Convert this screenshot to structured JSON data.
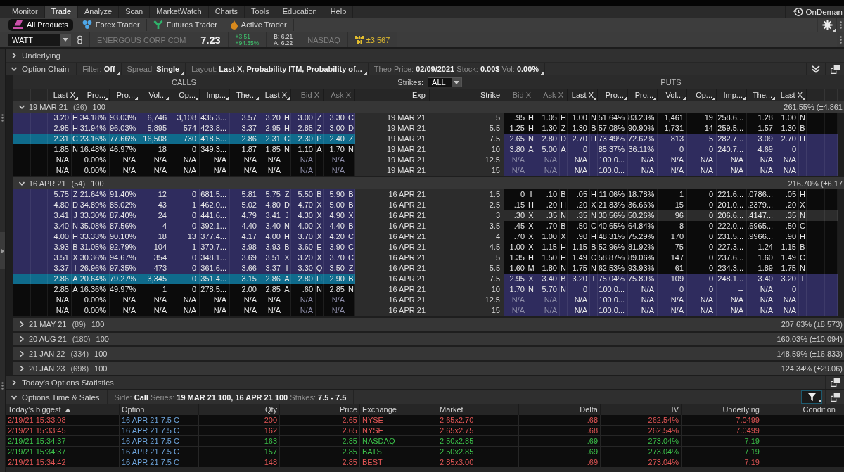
{
  "menu": {
    "tabs": [
      {
        "label": "Monitor",
        "selected": false
      },
      {
        "label": "Trade",
        "selected": true
      },
      {
        "label": "Analyze",
        "selected": false
      },
      {
        "label": "Scan",
        "selected": false
      },
      {
        "label": "MarketWatch",
        "selected": false
      },
      {
        "label": "Charts",
        "selected": false
      },
      {
        "label": "Tools",
        "selected": false
      },
      {
        "label": "Education",
        "selected": false
      },
      {
        "label": "Help",
        "selected": false
      }
    ],
    "ondemand": "OnDeman"
  },
  "product_tabs": [
    {
      "label": "All Products",
      "selected": true
    },
    {
      "label": "Forex Trader",
      "selected": false
    },
    {
      "label": "Futures Trader",
      "selected": false
    },
    {
      "label": "Active Trader",
      "selected": false
    }
  ],
  "symbol_bar": {
    "symbol": "WATT",
    "description": "ENERGOUS CORP COM",
    "last": "7.23",
    "net_change": "+3.51",
    "percent_change": "+94.35%",
    "bid": "B: 6.21",
    "ask": "A: 6.22",
    "exchange": "NASDAQ",
    "expected_move": "±3.567"
  },
  "underlying": {
    "label": "Underlying",
    "expanded": false
  },
  "option_chain": {
    "label": "Option Chain",
    "expanded": true,
    "controls": [
      {
        "parts": [
          {
            "label": "Filter:",
            "value": "Off"
          }
        ]
      },
      {
        "parts": [
          {
            "label": "Spread:",
            "value": "Single"
          }
        ]
      },
      {
        "parts": [
          {
            "label": "Layout:",
            "value": "Last X, Probability ITM, Probability of..."
          }
        ]
      },
      {
        "parts": [
          {
            "label": "Theo Price:",
            "value": "02/09/2021"
          },
          {
            "label": "Stock:",
            "value": "0.00$"
          },
          {
            "label": "Vol:",
            "value": "0.00%"
          }
        ]
      }
    ]
  },
  "chain": {
    "calls_label": "CALLS",
    "puts_label": "PUTS",
    "strikes": {
      "label": "Strikes:",
      "value": "ALL"
    },
    "call_columns": [
      {
        "label": "Last X",
        "kind": "trade",
        "menu": true
      },
      {
        "label": "Pro...",
        "kind": "stat",
        "menu": true
      },
      {
        "label": "Pro...",
        "kind": "stat",
        "menu": true
      },
      {
        "label": "Vol...",
        "kind": "stat",
        "menu": true
      },
      {
        "label": "Op...",
        "kind": "stat",
        "menu": true
      },
      {
        "label": "Imp...",
        "kind": "stat",
        "menu": true
      },
      {
        "label": "The...",
        "kind": "stat",
        "menu": true
      },
      {
        "label": "Last X",
        "kind": "trade",
        "menu": true
      },
      {
        "label": "Bid X",
        "kind": "quote",
        "menu": false
      },
      {
        "label": "Ask X",
        "kind": "quote",
        "menu": false
      }
    ],
    "middle_columns": [
      {
        "label": "Exp"
      },
      {
        "label": "Strike"
      }
    ],
    "put_columns": [
      {
        "label": "Bid X",
        "kind": "quote",
        "menu": false
      },
      {
        "label": "Ask X",
        "kind": "quote",
        "menu": false
      },
      {
        "label": "Last X",
        "kind": "trade",
        "menu": true
      },
      {
        "label": "Pro...",
        "kind": "stat",
        "menu": true
      },
      {
        "label": "Pro...",
        "kind": "stat",
        "menu": true
      },
      {
        "label": "Vol...",
        "kind": "stat",
        "menu": true
      },
      {
        "label": "Op...",
        "kind": "stat",
        "menu": true
      },
      {
        "label": "Imp...",
        "kind": "stat",
        "menu": true
      },
      {
        "label": "The...",
        "kind": "stat",
        "menu": true
      },
      {
        "label": "Last X",
        "kind": "trade",
        "menu": true
      }
    ],
    "series": [
      {
        "expiration": "19 MAR 21",
        "days": "(26)",
        "multiplier": "100",
        "volatility": "261.55% (±4.861",
        "expanded": true,
        "rows": [
          {
            "exp": "19 MAR 21",
            "strike": "5",
            "selected": false,
            "call_itm": true,
            "put_itm": false,
            "hovered": false,
            "quoted": true,
            "calls": [
              [
                "3.20",
                "H"
              ],
              "34.18%",
              "93.03%",
              "6,746",
              "3,108",
              "435.3...",
              "3.57",
              [
                "3.20",
                "H"
              ],
              [
                "3.00",
                "Z"
              ],
              [
                "3.30",
                "C"
              ]
            ],
            "puts": [
              [
                ".95",
                "H"
              ],
              [
                "1.05",
                "H"
              ],
              [
                "1.00",
                "N"
              ],
              "51.64%",
              "83.23%",
              "1,461",
              "19",
              "258.6...",
              "1.28",
              [
                "1.00",
                "N"
              ]
            ]
          },
          {
            "exp": "19 MAR 21",
            "strike": "5.5",
            "selected": false,
            "call_itm": true,
            "put_itm": false,
            "hovered": false,
            "quoted": true,
            "calls": [
              [
                "2.95",
                "H"
              ],
              "31.94%",
              "96.03%",
              "5,895",
              "574",
              "423.8...",
              "3.37",
              [
                "2.95",
                "H"
              ],
              [
                "2.85",
                "Z"
              ],
              [
                "3.00",
                "D"
              ]
            ],
            "puts": [
              [
                "1.25",
                "H"
              ],
              [
                "1.30",
                "Z"
              ],
              [
                "1.30",
                "B"
              ],
              "57.08%",
              "90.90%",
              "1,731",
              "14",
              "259.5...",
              "1.57",
              [
                "1.30",
                "B"
              ]
            ]
          },
          {
            "exp": "19 MAR 21",
            "strike": "7.5",
            "selected": true,
            "call_itm": false,
            "put_itm": true,
            "hovered": false,
            "quoted": true,
            "calls": [
              [
                "2.31",
                "C"
              ],
              "23.16%",
              "77.66%",
              "16,508",
              "730",
              "418.5...",
              "2.86",
              [
                "2.31",
                "C"
              ],
              [
                "2.30",
                "P"
              ],
              [
                "2.40",
                "Z"
              ]
            ],
            "puts": [
              [
                "2.65",
                "N"
              ],
              [
                "2.80",
                "D"
              ],
              [
                "2.70",
                "H"
              ],
              "73.49%",
              "72.62%",
              "813",
              "5",
              "282.7...",
              "3.09",
              [
                "2.70",
                "H"
              ]
            ]
          },
          {
            "exp": "19 MAR 21",
            "strike": "10",
            "selected": false,
            "call_itm": false,
            "put_itm": true,
            "hovered": false,
            "quoted": true,
            "calls": [
              [
                "1.85",
                "N"
              ],
              "16.48%",
              "46.97%",
              "18",
              "0",
              "349.3...",
              "1.87",
              [
                "1.85",
                "N"
              ],
              [
                "1.10",
                "A"
              ],
              [
                "1.70",
                "N"
              ]
            ],
            "puts": [
              [
                "3.80",
                "A"
              ],
              [
                "5.00",
                "A"
              ],
              [
                "0"
              ],
              "85.37%",
              "36.11%",
              "0",
              "0",
              "240.7...",
              "4.69",
              [
                "0"
              ]
            ]
          },
          {
            "exp": "19 MAR 21",
            "strike": "12.5",
            "selected": false,
            "call_itm": false,
            "put_itm": true,
            "hovered": false,
            "quoted": false,
            "calls": [
              [
                "N/A"
              ],
              "0.00%",
              "N/A",
              "N/A",
              "N/A",
              "N/A",
              "N/A",
              [
                "N/A"
              ],
              [
                "N/A"
              ],
              [
                "N/A"
              ]
            ],
            "puts": [
              [
                "N/A"
              ],
              [
                "N/A"
              ],
              [
                "N/A"
              ],
              "100.0...",
              "N/A",
              "N/A",
              "N/A",
              "N/A",
              "N/A",
              [
                "N/A"
              ]
            ]
          },
          {
            "exp": "19 MAR 21",
            "strike": "15",
            "selected": false,
            "call_itm": false,
            "put_itm": true,
            "hovered": false,
            "quoted": false,
            "calls": [
              [
                "N/A"
              ],
              "0.00%",
              "N/A",
              "N/A",
              "N/A",
              "N/A",
              "N/A",
              [
                "N/A"
              ],
              [
                "N/A"
              ],
              [
                "N/A"
              ]
            ],
            "puts": [
              [
                "N/A"
              ],
              [
                "N/A"
              ],
              [
                "N/A"
              ],
              "100.0...",
              "N/A",
              "N/A",
              "N/A",
              "N/A",
              "N/A",
              [
                "N/A"
              ]
            ]
          }
        ]
      },
      {
        "expiration": "16 APR 21",
        "days": "(54)",
        "multiplier": "100",
        "volatility": "216.70% (±6.17",
        "expanded": true,
        "rows": [
          {
            "exp": "16 APR 21",
            "strike": "1.5",
            "selected": false,
            "call_itm": true,
            "put_itm": false,
            "hovered": false,
            "quoted": true,
            "calls": [
              [
                "5.75",
                "Z"
              ],
              "21.64%",
              "91.40%",
              "12",
              "0",
              "681.5...",
              "5.81",
              [
                "5.75",
                "Z"
              ],
              [
                "5.50",
                "B"
              ],
              [
                "5.90",
                "B"
              ]
            ],
            "puts": [
              [
                "0",
                "I"
              ],
              [
                ".10",
                "B"
              ],
              [
                ".05",
                "H"
              ],
              "11.06%",
              "18.78%",
              "1",
              "0",
              "221.6...",
              ".0786...",
              [
                ".05",
                "H"
              ]
            ]
          },
          {
            "exp": "16 APR 21",
            "strike": "2.5",
            "selected": false,
            "call_itm": true,
            "put_itm": false,
            "hovered": false,
            "quoted": true,
            "calls": [
              [
                "4.80",
                "D"
              ],
              "34.89%",
              "85.02%",
              "43",
              "1",
              "462.0...",
              "5.02",
              [
                "4.80",
                "D"
              ],
              [
                "4.70",
                "X"
              ],
              [
                "5.00",
                "B"
              ]
            ],
            "puts": [
              [
                ".15",
                "H"
              ],
              [
                ".20",
                "H"
              ],
              [
                ".20",
                "X"
              ],
              "21.83%",
              "36.66%",
              "15",
              "0",
              "201.0...",
              ".2379...",
              [
                ".20",
                "X"
              ]
            ]
          },
          {
            "exp": "16 APR 21",
            "strike": "3",
            "selected": false,
            "call_itm": true,
            "put_itm": false,
            "hovered": true,
            "quoted": true,
            "calls": [
              [
                "3.41",
                "J"
              ],
              "33.30%",
              "87.40%",
              "24",
              "0",
              "441.6...",
              "4.79",
              [
                "3.41",
                "J"
              ],
              [
                "4.30",
                "X"
              ],
              [
                "4.90",
                "X"
              ]
            ],
            "puts": [
              [
                ".30",
                "X"
              ],
              [
                ".35",
                "N"
              ],
              [
                ".35",
                "N"
              ],
              "30.56%",
              "50.26%",
              "96",
              "0",
              "206.6...",
              ".4147...",
              [
                ".35",
                "N"
              ]
            ]
          },
          {
            "exp": "16 APR 21",
            "strike": "3.5",
            "selected": false,
            "call_itm": true,
            "put_itm": false,
            "hovered": false,
            "quoted": true,
            "calls": [
              [
                "3.40",
                "N"
              ],
              "35.08%",
              "87.56%",
              "4",
              "0",
              "392.1...",
              "4.40",
              [
                "3.40",
                "N"
              ],
              [
                "4.00",
                "X"
              ],
              [
                "4.40",
                "B"
              ]
            ],
            "puts": [
              [
                ".45",
                "X"
              ],
              [
                ".70",
                "B"
              ],
              [
                ".50",
                "C"
              ],
              "40.65%",
              "64.84%",
              "8",
              "0",
              "222.0...",
              ".6965...",
              [
                ".50",
                "C"
              ]
            ]
          },
          {
            "exp": "16 APR 21",
            "strike": "4",
            "selected": false,
            "call_itm": true,
            "put_itm": false,
            "hovered": false,
            "quoted": true,
            "calls": [
              [
                "4.00",
                "H"
              ],
              "33.33%",
              "90.10%",
              "18",
              "13",
              "377.4...",
              "4.17",
              [
                "4.00",
                "H"
              ],
              [
                "3.70",
                "X"
              ],
              [
                "4.20",
                "C"
              ]
            ],
            "puts": [
              [
                ".70",
                "X"
              ],
              [
                "1.00",
                "X"
              ],
              [
                ".90",
                "H"
              ],
              "48.31%",
              "75.29%",
              "170",
              "0",
              "231.5...",
              ".9966...",
              [
                ".90",
                "H"
              ]
            ]
          },
          {
            "exp": "16 APR 21",
            "strike": "4.5",
            "selected": false,
            "call_itm": true,
            "put_itm": false,
            "hovered": false,
            "quoted": true,
            "calls": [
              [
                "3.93",
                "B"
              ],
              "31.05%",
              "92.79%",
              "104",
              "1",
              "370.7...",
              "3.98",
              [
                "3.93",
                "B"
              ],
              [
                "3.60",
                "E"
              ],
              [
                "3.90",
                "C"
              ]
            ],
            "puts": [
              [
                "1.00",
                "X"
              ],
              [
                "1.15",
                "H"
              ],
              [
                "1.15",
                "B"
              ],
              "52.96%",
              "81.92%",
              "75",
              "0",
              "227.3...",
              "1.24",
              [
                "1.15",
                "B"
              ]
            ]
          },
          {
            "exp": "16 APR 21",
            "strike": "5",
            "selected": false,
            "call_itm": true,
            "put_itm": false,
            "hovered": false,
            "quoted": true,
            "calls": [
              [
                "3.51",
                "X"
              ],
              "30.36%",
              "94.67%",
              "354",
              "0",
              "348.1...",
              "3.69",
              [
                "3.51",
                "X"
              ],
              [
                "3.20",
                "X"
              ],
              [
                "3.70",
                "C"
              ]
            ],
            "puts": [
              [
                "1.35",
                "H"
              ],
              [
                "1.50",
                "H"
              ],
              [
                "1.49",
                "C"
              ],
              "58.87%",
              "89.06%",
              "147",
              "0",
              "237.6...",
              "1.60",
              [
                "1.49",
                "C"
              ]
            ]
          },
          {
            "exp": "16 APR 21",
            "strike": "5.5",
            "selected": false,
            "call_itm": true,
            "put_itm": false,
            "hovered": false,
            "quoted": true,
            "calls": [
              [
                "3.37",
                "I"
              ],
              "26.96%",
              "97.35%",
              "473",
              "0",
              "361.6...",
              "3.66",
              [
                "3.37",
                "I"
              ],
              [
                "3.30",
                "Q"
              ],
              [
                "3.50",
                "Z"
              ]
            ],
            "puts": [
              [
                "1.60",
                "M"
              ],
              [
                "1.80",
                "N"
              ],
              [
                "1.75",
                "N"
              ],
              "62.53%",
              "93.93%",
              "61",
              "0",
              "234.3...",
              "1.89",
              [
                "1.75",
                "N"
              ]
            ]
          },
          {
            "exp": "16 APR 21",
            "strike": "7.5",
            "selected": true,
            "call_itm": false,
            "put_itm": true,
            "hovered": false,
            "quoted": true,
            "calls": [
              [
                "2.86",
                "A"
              ],
              "20.64%",
              "79.27%",
              "3,345",
              "0",
              "351.4...",
              "3.15",
              [
                "2.86",
                "A"
              ],
              [
                "2.80",
                "H"
              ],
              [
                "2.90",
                "B"
              ]
            ],
            "puts": [
              [
                "2.95",
                "X"
              ],
              [
                "3.40",
                "B"
              ],
              [
                "3.20",
                "I"
              ],
              "75.04%",
              "75.80%",
              "109",
              "0",
              "248.1...",
              "3.40",
              [
                "3.20",
                "I"
              ]
            ]
          },
          {
            "exp": "16 APR 21",
            "strike": "10",
            "selected": false,
            "call_itm": false,
            "put_itm": true,
            "hovered": false,
            "quoted": true,
            "calls": [
              [
                "2.85",
                "A"
              ],
              "16.36%",
              "49.97%",
              "1",
              "0",
              "278.5...",
              "2.00",
              [
                "2.85",
                "A"
              ],
              [
                ".60",
                "N"
              ],
              [
                "2.85",
                "N"
              ]
            ],
            "puts": [
              [
                "1.70",
                "N"
              ],
              [
                "5.70",
                "N"
              ],
              [
                "0"
              ],
              "100.0...",
              "N/A",
              "0",
              "0",
              "--",
              "N/A",
              [
                "0"
              ]
            ]
          },
          {
            "exp": "16 APR 21",
            "strike": "12.5",
            "selected": false,
            "call_itm": false,
            "put_itm": true,
            "hovered": false,
            "quoted": false,
            "calls": [
              [
                "N/A"
              ],
              "0.00%",
              "N/A",
              "N/A",
              "N/A",
              "N/A",
              "N/A",
              [
                "N/A"
              ],
              [
                "N/A"
              ],
              [
                "N/A"
              ]
            ],
            "puts": [
              [
                "N/A"
              ],
              [
                "N/A"
              ],
              [
                "N/A"
              ],
              "100.0...",
              "N/A",
              "N/A",
              "N/A",
              "N/A",
              "N/A",
              [
                "N/A"
              ]
            ]
          },
          {
            "exp": "16 APR 21",
            "strike": "15",
            "selected": false,
            "call_itm": false,
            "put_itm": true,
            "hovered": false,
            "quoted": false,
            "calls": [
              [
                "N/A"
              ],
              "0.00%",
              "N/A",
              "N/A",
              "N/A",
              "N/A",
              "N/A",
              [
                "N/A"
              ],
              [
                "N/A"
              ],
              [
                "N/A"
              ]
            ],
            "puts": [
              [
                "N/A"
              ],
              [
                "N/A"
              ],
              [
                "N/A"
              ],
              "100.0...",
              "N/A",
              "N/A",
              "N/A",
              "N/A",
              "N/A",
              [
                "N/A"
              ]
            ]
          }
        ]
      },
      {
        "expiration": "21 MAY 21",
        "days": "(89)",
        "multiplier": "100",
        "volatility": "207.63% (±8.573)",
        "expanded": false
      },
      {
        "expiration": "20 AUG 21",
        "days": "(180)",
        "multiplier": "100",
        "volatility": "160.03% (±10.094)",
        "expanded": false
      },
      {
        "expiration": "21 JAN 22",
        "days": "(334)",
        "multiplier": "100",
        "volatility": "148.59% (±16.833)",
        "expanded": false
      },
      {
        "expiration": "20 JAN 23",
        "days": "(698)",
        "multiplier": "100",
        "volatility": "124.34% (±29.06)",
        "expanded": false
      }
    ]
  },
  "options_statistics": {
    "label": "Today's Options Statistics",
    "expanded": false
  },
  "time_sales": {
    "label": "Options Time & Sales",
    "expanded": true,
    "filters": [
      {
        "label": "Side:",
        "value": "Call"
      },
      {
        "label": "Series:",
        "value": "19 MAR 21 100, 16 APR 21 100"
      },
      {
        "label": "Strikes:",
        "value": "7.5 - 7.5"
      }
    ],
    "columns": [
      {
        "label": "Today's biggest",
        "sorted": true
      },
      {
        "label": "Option",
        "sorted": false
      },
      {
        "label": "Qty",
        "sorted": false
      },
      {
        "label": "Price",
        "sorted": false
      },
      {
        "label": "Exchange",
        "sorted": false
      },
      {
        "label": "Market",
        "sorted": false
      },
      {
        "label": "Delta",
        "sorted": false
      },
      {
        "label": "IV",
        "sorted": false
      },
      {
        "label": "Underlying",
        "sorted": false
      },
      {
        "label": "Condition",
        "sorted": false
      }
    ],
    "rows": [
      {
        "color": "#e35656",
        "cells": [
          "2/19/21 15:33:08",
          "16 APR 21 7.5 C",
          "200",
          "2.65",
          "NYSE",
          "2.65x2.70",
          ".68",
          "262.54%",
          "7.0499"
        ]
      },
      {
        "color": "#e35656",
        "cells": [
          "2/19/21 15:33:45",
          "16 APR 21 7.5 C",
          "162",
          "2.65",
          "NYSE",
          "2.65x2.75",
          ".68",
          "262.54%",
          "7.0499"
        ]
      },
      {
        "color": "#3cc04a",
        "cells": [
          "2/19/21 15:34:37",
          "16 APR 21 7.5 C",
          "163",
          "2.85",
          "NASDAQ",
          "2.50x2.85",
          ".69",
          "273.04%",
          "7.19"
        ]
      },
      {
        "color": "#3cc04a",
        "cells": [
          "2/19/21 15:34:37",
          "16 APR 21 7.5 C",
          "157",
          "2.85",
          "BATS",
          "2.50x2.85",
          ".69",
          "273.04%",
          "7.19"
        ]
      },
      {
        "color": "#e35656",
        "cells": [
          "2/19/21 15:34:42",
          "16 APR 21 7.5 C",
          "148",
          "2.85",
          "BEST",
          "2.85x3.00",
          ".69",
          "273.04%",
          "7.19"
        ]
      }
    ]
  }
}
